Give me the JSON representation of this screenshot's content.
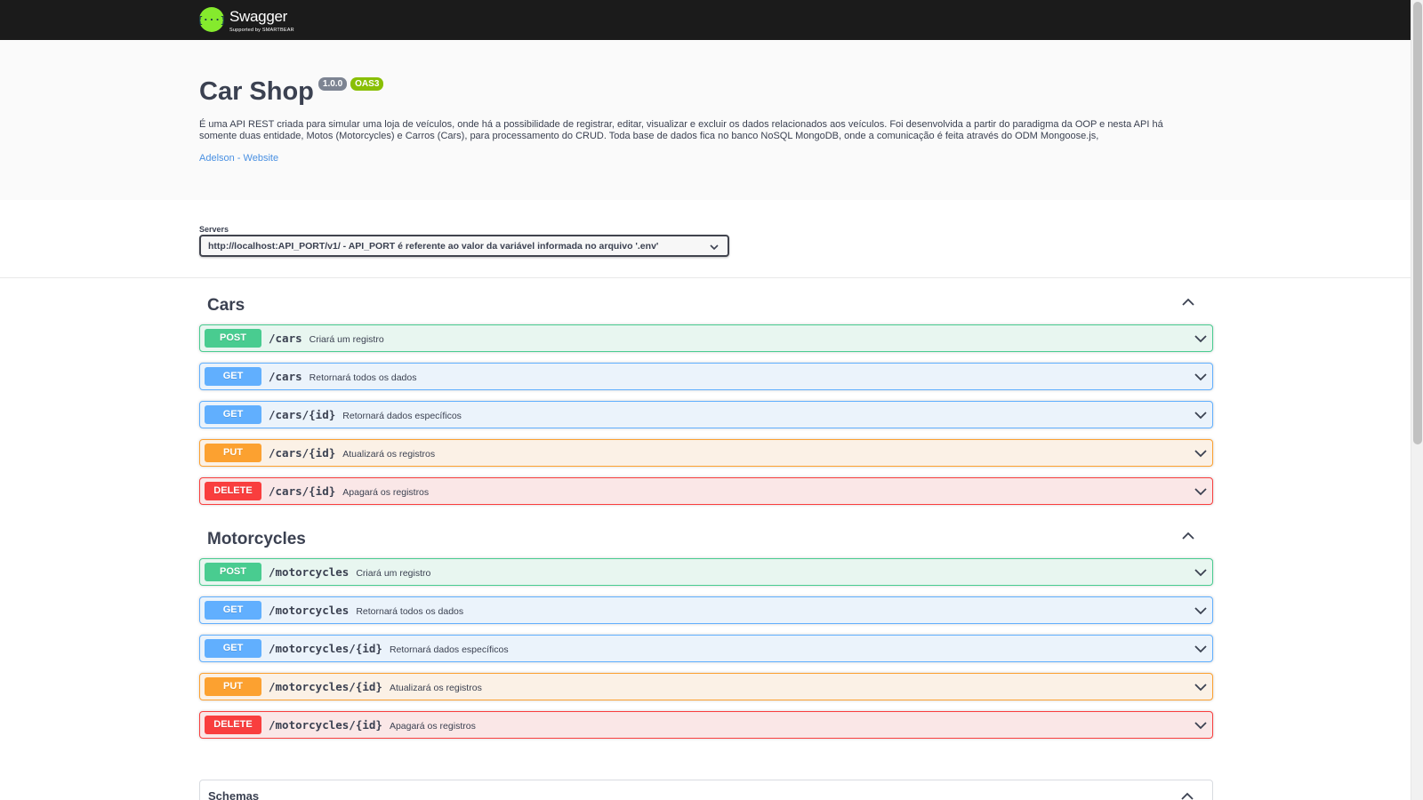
{
  "topbar": {
    "logo_text": "Swagger",
    "logo_sub": "Supported by SMARTBEAR"
  },
  "info": {
    "title": "Car Shop",
    "version": "1.0.0",
    "oas": "OAS3",
    "description": "É uma API REST criada para simular uma loja de veículos, onde há a possibilidade de registrar, editar, visualizar e excluir os dados relacionados aos veículos. Foi desenvolvida a partir do paradigma da OOP e nesta API há somente duas entidade, Motos (Motorcycles) e Carros (Cars), para processamento do CRUD. Toda base de dados fica no banco NoSQL MongoDB, onde a comunicação é feita através do ODM Mongoose.js,",
    "contact_link": "Adelson - Website"
  },
  "servers": {
    "label": "Servers",
    "selected": "http://localhost:API_PORT/v1/ - API_PORT é referente ao valor da variável informada no arquivo '.env'"
  },
  "tags": [
    {
      "name": "Cars",
      "operations": [
        {
          "method": "POST",
          "path": "/cars",
          "summary": "Criará um registro"
        },
        {
          "method": "GET",
          "path": "/cars",
          "summary": "Retornará todos os dados"
        },
        {
          "method": "GET",
          "path": "/cars/{id}",
          "summary": "Retornará dados específicos"
        },
        {
          "method": "PUT",
          "path": "/cars/{id}",
          "summary": "Atualizará os registros"
        },
        {
          "method": "DELETE",
          "path": "/cars/{id}",
          "summary": "Apagará os registros"
        }
      ]
    },
    {
      "name": "Motorcycles",
      "operations": [
        {
          "method": "POST",
          "path": "/motorcycles",
          "summary": "Criará um registro"
        },
        {
          "method": "GET",
          "path": "/motorcycles",
          "summary": "Retornará todos os dados"
        },
        {
          "method": "GET",
          "path": "/motorcycles/{id}",
          "summary": "Retornará dados específicos"
        },
        {
          "method": "PUT",
          "path": "/motorcycles/{id}",
          "summary": "Atualizará os registros"
        },
        {
          "method": "DELETE",
          "path": "/motorcycles/{id}",
          "summary": "Apagará os registros"
        }
      ]
    }
  ],
  "schemas": {
    "title": "Schemas"
  },
  "colors": {
    "post": "#49cc90",
    "get": "#61affe",
    "put": "#fca130",
    "delete": "#f93e3e",
    "topbar": "#1b1b1b",
    "logo": "#85ea2d",
    "link": "#4990e2"
  },
  "icons": {
    "logo": "swagger-logo-icon",
    "select": "chevron-down-icon",
    "tag_toggle": "chevron-up-icon",
    "op_toggle": "chevron-down-icon"
  }
}
